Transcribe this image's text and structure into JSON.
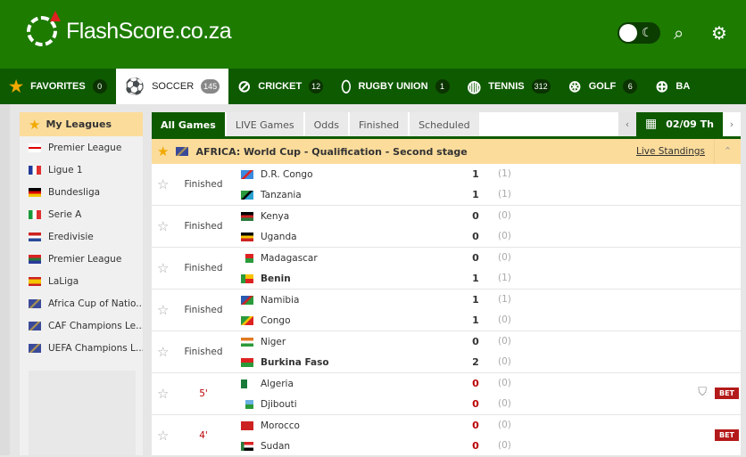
{
  "header": {
    "logo_text": "FlashScore.co.za",
    "icons": [
      "theme-toggle-icon",
      "search-icon",
      "gear-icon"
    ]
  },
  "nav": [
    {
      "label": "FAVORITES",
      "count": "0",
      "icon": "★"
    },
    {
      "label": "SOCCER",
      "count": "145",
      "icon": "⚽",
      "active": true
    },
    {
      "label": "CRICKET",
      "count": "12",
      "icon": "⊘"
    },
    {
      "label": "RUGBY UNION",
      "count": "1",
      "icon": "⬯"
    },
    {
      "label": "TENNIS",
      "count": "312",
      "icon": "◍"
    },
    {
      "label": "GOLF",
      "count": "6",
      "icon": "⊛"
    },
    {
      "label": "BA",
      "count": "",
      "icon": "⊕"
    }
  ],
  "sidebar": {
    "title": "My Leagues",
    "leagues": [
      {
        "name": "Premier League",
        "flag": "eng"
      },
      {
        "name": "Ligue 1",
        "flag": "fra"
      },
      {
        "name": "Bundesliga",
        "flag": "ger"
      },
      {
        "name": "Serie A",
        "flag": "ita"
      },
      {
        "name": "Eredivisie",
        "flag": "ned"
      },
      {
        "name": "Premier League",
        "flag": "rsa"
      },
      {
        "name": "LaLiga",
        "flag": "esp"
      },
      {
        "name": "Africa Cup of Natio...",
        "flag": "world"
      },
      {
        "name": "CAF Champions Le...",
        "flag": "world"
      },
      {
        "name": "UEFA Champions L...",
        "flag": "world"
      }
    ]
  },
  "tabs": [
    "All Games",
    "LIVE Games",
    "Odds",
    "Finished",
    "Scheduled"
  ],
  "date": "02/09 Th",
  "league": {
    "name": "AFRICA: World Cup - Qualification - Second stage",
    "standings": "Live Standings"
  },
  "matches": [
    {
      "status": "Finished",
      "live": false,
      "home": {
        "name": "D.R. Congo",
        "flag": "cod",
        "score": "1",
        "ht": "(1)",
        "win": false
      },
      "away": {
        "name": "Tanzania",
        "flag": "tza",
        "score": "1",
        "ht": "(1)",
        "win": false
      }
    },
    {
      "status": "Finished",
      "live": false,
      "home": {
        "name": "Kenya",
        "flag": "ken",
        "score": "0",
        "ht": "(0)",
        "win": false
      },
      "away": {
        "name": "Uganda",
        "flag": "uga",
        "score": "0",
        "ht": "(0)",
        "win": false
      }
    },
    {
      "status": "Finished",
      "live": false,
      "home": {
        "name": "Madagascar",
        "flag": "mad",
        "score": "0",
        "ht": "(0)",
        "win": false
      },
      "away": {
        "name": "Benin",
        "flag": "ben",
        "score": "1",
        "ht": "(1)",
        "win": true
      }
    },
    {
      "status": "Finished",
      "live": false,
      "home": {
        "name": "Namibia",
        "flag": "nam",
        "score": "1",
        "ht": "(1)",
        "win": false
      },
      "away": {
        "name": "Congo",
        "flag": "cgo",
        "score": "1",
        "ht": "(0)",
        "win": false
      }
    },
    {
      "status": "Finished",
      "live": false,
      "home": {
        "name": "Niger",
        "flag": "nig",
        "score": "0",
        "ht": "(0)",
        "win": false
      },
      "away": {
        "name": "Burkina Faso",
        "flag": "bfa",
        "score": "2",
        "ht": "(0)",
        "win": true
      }
    },
    {
      "status": "5'",
      "live": true,
      "shirt": true,
      "bet": "BET",
      "home": {
        "name": "Algeria",
        "flag": "alg",
        "score": "0",
        "ht": "(0)",
        "win": false
      },
      "away": {
        "name": "Djibouti",
        "flag": "dji",
        "score": "0",
        "ht": "(0)",
        "win": false
      }
    },
    {
      "status": "4'",
      "live": true,
      "bet": "BET",
      "home": {
        "name": "Morocco",
        "flag": "mar",
        "score": "0",
        "ht": "(0)",
        "win": false
      },
      "away": {
        "name": "Sudan",
        "flag": "sud",
        "score": "0",
        "ht": "(0)",
        "win": false
      }
    }
  ]
}
